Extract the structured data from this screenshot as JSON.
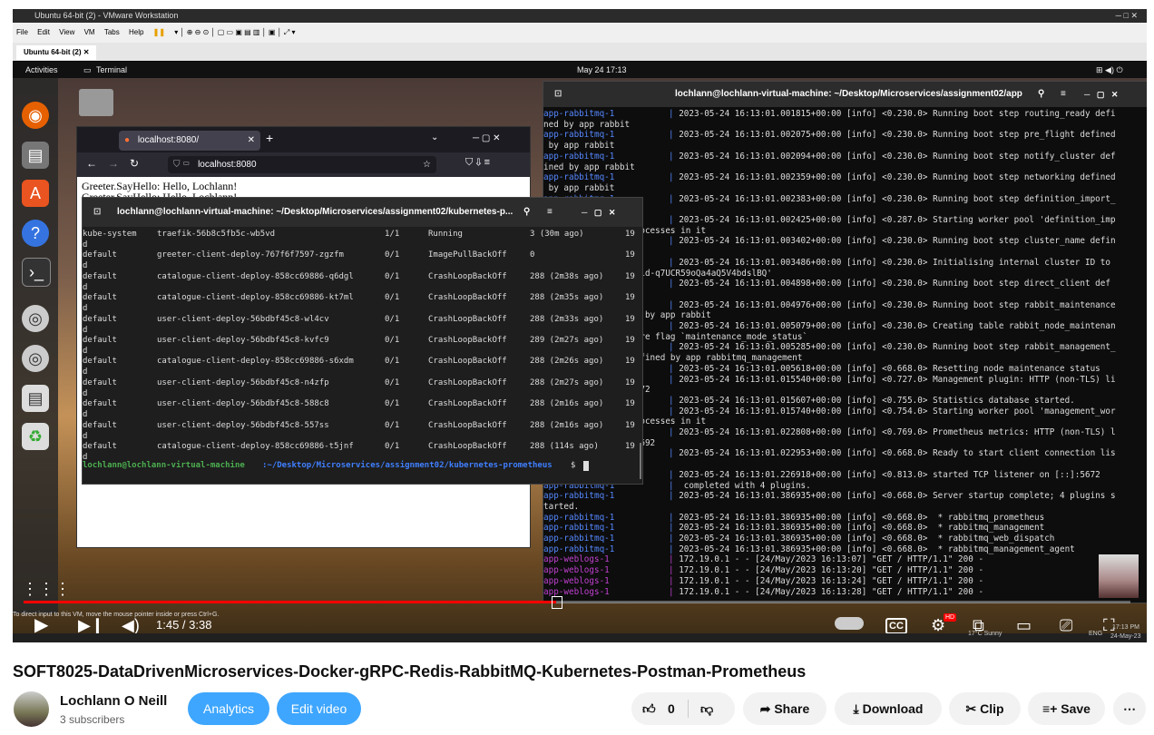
{
  "vmware": {
    "title": "Ubuntu 64-bit (2) - VMware Workstation",
    "menu": [
      "File",
      "Edit",
      "View",
      "VM",
      "Tabs",
      "Help"
    ],
    "tab_label": "Ubuntu 64-bit (2)"
  },
  "gnome": {
    "activities": "Activities",
    "app": "Terminal",
    "clock": "May 24  17:13"
  },
  "browser": {
    "tab_title": "localhost:8080/",
    "url": "localhost:8080",
    "content_lines": [
      "Greeter.SayHello: Hello, Lochlann!",
      "Greeter.SayHello: Hello, Lochlann!"
    ]
  },
  "terminal_small": {
    "title": "lochlann@lochlann-virtual-machine: ~/Desktop/Microservices/assignment02/kubernetes-p...",
    "rows": [
      {
        "ns": "kube-system",
        "name": "traefik-56b8c5fb5c-wb5vd",
        "ready": "1/1",
        "status": "Running",
        "restarts": "3 (30m ago)",
        "age": "19"
      },
      {
        "ns": "default",
        "name": "greeter-client-deploy-767f6f7597-zgzfm",
        "ready": "0/1",
        "status": "ImagePullBackOff",
        "restarts": "0",
        "age": "19"
      },
      {
        "ns": "default",
        "name": "catalogue-client-deploy-858cc69886-q6dgl",
        "ready": "0/1",
        "status": "CrashLoopBackOff",
        "restarts": "288 (2m38s ago)",
        "age": "19"
      },
      {
        "ns": "default",
        "name": "catalogue-client-deploy-858cc69886-kt7ml",
        "ready": "0/1",
        "status": "CrashLoopBackOff",
        "restarts": "288 (2m35s ago)",
        "age": "19"
      },
      {
        "ns": "default",
        "name": "user-client-deploy-56bdbf45c8-wl4cv",
        "ready": "0/1",
        "status": "CrashLoopBackOff",
        "restarts": "288 (2m33s ago)",
        "age": "19"
      },
      {
        "ns": "default",
        "name": "user-client-deploy-56bdbf45c8-kvfc9",
        "ready": "0/1",
        "status": "CrashLoopBackOff",
        "restarts": "289 (2m27s ago)",
        "age": "19"
      },
      {
        "ns": "default",
        "name": "catalogue-client-deploy-858cc69886-s6xdm",
        "ready": "0/1",
        "status": "CrashLoopBackOff",
        "restarts": "288 (2m26s ago)",
        "age": "19"
      },
      {
        "ns": "default",
        "name": "user-client-deploy-56bdbf45c8-n4zfp",
        "ready": "0/1",
        "status": "CrashLoopBackOff",
        "restarts": "288 (2m27s ago)",
        "age": "19"
      },
      {
        "ns": "default",
        "name": "user-client-deploy-56bdbf45c8-588c8",
        "ready": "0/1",
        "status": "CrashLoopBackOff",
        "restarts": "288 (2m16s ago)",
        "age": "19"
      },
      {
        "ns": "default",
        "name": "user-client-deploy-56bdbf45c8-557ss",
        "ready": "0/1",
        "status": "CrashLoopBackOff",
        "restarts": "288 (2m16s ago)",
        "age": "19"
      },
      {
        "ns": "default",
        "name": "catalogue-client-deploy-858cc69886-t5jnf",
        "ready": "0/1",
        "status": "CrashLoopBackOff",
        "restarts": "288 (114s ago)",
        "age": "19"
      }
    ],
    "prompt_user": "lochlann@lochlann-virtual-machine",
    "prompt_path": ":~/Desktop/Microservices/assignment02/kubernetes-prometheus",
    "prompt_symbol": "$"
  },
  "terminal_big": {
    "title": "lochlann@lochlann-virtual-machine: ~/Desktop/Microservices/assignment02/app",
    "lines": [
      [
        "app-rabbitmq-1",
        "2023-05-24 16:13:01.001815+00:00 [info] <0.230.0> Running boot step routing_ready defi"
      ],
      [
        "",
        "ned by app rabbit"
      ],
      [
        "app-rabbitmq-1",
        "2023-05-24 16:13:01.002075+00:00 [info] <0.230.0> Running boot step pre_flight defined"
      ],
      [
        "",
        " by app rabbit"
      ],
      [
        "app-rabbitmq-1",
        "2023-05-24 16:13:01.002094+00:00 [info] <0.230.0> Running boot step notify_cluster def"
      ],
      [
        "",
        "ined by app rabbit"
      ],
      [
        "app-rabbitmq-1",
        "2023-05-24 16:13:01.002359+00:00 [info] <0.230.0> Running boot step networking defined"
      ],
      [
        "",
        " by app rabbit"
      ],
      [
        "app-rabbitmq-1",
        "2023-05-24 16:13:01.002383+00:00 [info] <0.230.0> Running boot step definition_import_"
      ],
      [
        "",
        "d by app rabbit"
      ],
      [
        "app-rabbitmq-1",
        "2023-05-24 16:13:01.002425+00:00 [info] <0.287.0> Starting worker pool 'definition_imp"
      ],
      [
        "",
        "ort_pool' with 2 processes in it"
      ],
      [
        "app-rabbitmq-1",
        "2023-05-24 16:13:01.003402+00:00 [info] <0.230.0> Running boot step cluster_name defin"
      ],
      [
        "",
        "ed by app rabbit"
      ],
      [
        "app-rabbitmq-1",
        "2023-05-24 16:13:01.003486+00:00 [info] <0.230.0> Initialising internal cluster ID to"
      ],
      [
        "",
        " 'rabbitmq-cluster-id-q7UCR59oQa4aQ5V4bdslBQ'"
      ],
      [
        "app-rabbitmq-1",
        "2023-05-24 16:13:01.004898+00:00 [info] <0.230.0> Running boot step direct_client def"
      ],
      [
        "",
        "ined by app rabbit"
      ],
      [
        "app-rabbitmq-1",
        "2023-05-24 16:13:01.004976+00:00 [info] <0.230.0> Running boot step rabbit_maintenance"
      ],
      [
        "",
        "_mode_state defined by app rabbit"
      ],
      [
        "app-rabbitmq-1",
        "2023-05-24 16:13:01.005079+00:00 [info] <0.230.0> Creating table rabbit_node_maintenan"
      ],
      [
        "",
        "ce_states for feature flag `maintenance_mode_status`"
      ],
      [
        "app-rabbitmq-1",
        "2023-05-24 16:13:01.005285+00:00 [info] <0.230.0> Running boot step rabbit_management_"
      ],
      [
        "",
        "load_definitions defined by app rabbitmq_management"
      ],
      [
        "app-rabbitmq-1",
        "2023-05-24 16:13:01.005618+00:00 [info] <0.668.0> Resetting node maintenance status"
      ],
      [
        "app-rabbitmq-1",
        "2023-05-24 16:13:01.015540+00:00 [info] <0.727.0> Management plugin: HTTP (non-TLS) li"
      ],
      [
        "",
        "stening on port 15672"
      ],
      [
        "app-rabbitmq-1",
        "2023-05-24 16:13:01.015607+00:00 [info] <0.755.0> Statistics database started."
      ],
      [
        "app-rabbitmq-1",
        "2023-05-24 16:13:01.015740+00:00 [info] <0.754.0> Starting worker pool 'management_wor"
      ],
      [
        "",
        "ker_pool' with 3 processes in it"
      ],
      [
        "app-rabbitmq-1",
        "2023-05-24 16:13:01.022808+00:00 [info] <0.769.0> Prometheus metrics: HTTP (non-TLS) l"
      ],
      [
        "",
        "istening on port 15692"
      ],
      [
        "app-rabbitmq-1",
        "2023-05-24 16:13:01.022953+00:00 [info] <0.668.0> Ready to start client connection lis"
      ],
      [
        "",
        "teners"
      ],
      [
        "app-rabbitmq-1",
        "2023-05-24 16:13:01.226918+00:00 [info] <0.813.0> started TCP listener on [::]:5672"
      ],
      [
        "app-rabbitmq-1",
        " completed with 4 plugins."
      ],
      [
        "app-rabbitmq-1",
        "2023-05-24 16:13:01.386935+00:00 [info] <0.668.0> Server startup complete; 4 plugins s"
      ],
      [
        "",
        "tarted."
      ],
      [
        "app-rabbitmq-1",
        "2023-05-24 16:13:01.386935+00:00 [info] <0.668.0>  * rabbitmq_prometheus"
      ],
      [
        "app-rabbitmq-1",
        "2023-05-24 16:13:01.386935+00:00 [info] <0.668.0>  * rabbitmq_management"
      ],
      [
        "app-rabbitmq-1",
        "2023-05-24 16:13:01.386935+00:00 [info] <0.668.0>  * rabbitmq_web_dispatch"
      ],
      [
        "app-rabbitmq-1",
        "2023-05-24 16:13:01.386935+00:00 [info] <0.668.0>  * rabbitmq_management_agent"
      ],
      [
        "app-weblogs-1",
        "172.19.0.1 - - [24/May/2023 16:13:07] \"GET / HTTP/1.1\" 200 -"
      ],
      [
        "app-weblogs-1",
        "172.19.0.1 - - [24/May/2023 16:13:20] \"GET / HTTP/1.1\" 200 -"
      ],
      [
        "app-weblogs-1",
        "172.19.0.1 - - [24/May/2023 16:13:24] \"GET / HTTP/1.1\" 200 -"
      ],
      [
        "app-weblogs-1",
        "172.19.0.1 - - [24/May/2023 16:13:28] \"GET / HTTP/1.1\" 200 -"
      ]
    ]
  },
  "player": {
    "current_time": "1:45",
    "duration": "3:38",
    "time_display": "1:45 / 3:38",
    "progress": 0.481,
    "vm_hint": "To direct input to this VM, move the mouse pointer inside or press Ctrl+G.",
    "hd_badge": "HD",
    "cc": "CC"
  },
  "taskbar": {
    "weather": "17°C  Sunny",
    "lang": "ENG",
    "time": "17:13 PM",
    "date": "24-May-23"
  },
  "video": {
    "title": "SOFT8025-DataDrivenMicroservices-Docker-gRPC-Redis-RabbitMQ-Kubernetes-Postman-Prometheus",
    "channel": "Lochlann O Neill",
    "subscribers": "3 subscribers",
    "analytics": "Analytics",
    "edit": "Edit video",
    "likes": "0",
    "share": "Share",
    "download": "Download",
    "clip": "Clip",
    "save": "Save",
    "more": "⋯"
  },
  "colors": {
    "youtube_red": "#ff0000",
    "blue_button": "#3ea6ff",
    "rabbitmq_service": "#5588ff",
    "weblogs_service": "#c040d0",
    "prompt_green": "#4caf50"
  }
}
